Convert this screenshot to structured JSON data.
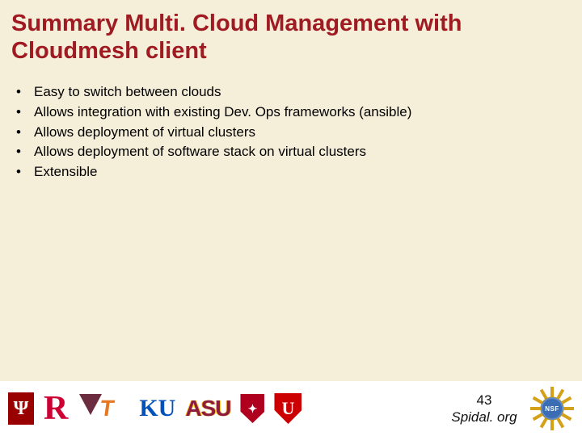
{
  "title": "Summary Multi. Cloud Management with Cloudmesh client",
  "bullets": [
    "Easy to switch between clouds",
    "Allows integration with existing Dev. Ops frameworks (ansible)",
    "Allows deployment of virtual clusters",
    "Allows deployment of software stack on virtual clusters",
    "Extensible"
  ],
  "footer": {
    "page_number": "43",
    "site_label": "Spidal. org",
    "logos": {
      "iu_glyph": "Ψ",
      "rutgers_glyph": "R",
      "ku_text": "KU",
      "asu_text": "ASU",
      "utah_glyph": "U",
      "nsf_text": "NSF"
    }
  }
}
